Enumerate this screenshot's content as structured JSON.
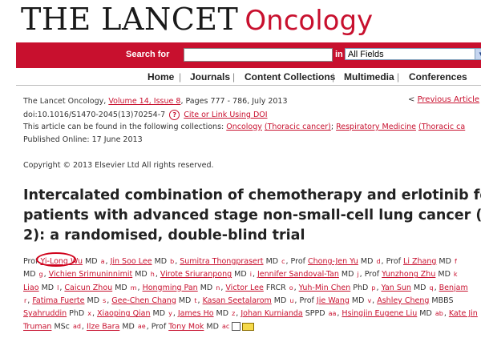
{
  "masthead": {
    "journal": "THE LANCET",
    "section": "Oncology"
  },
  "search": {
    "label": "Search for",
    "query": "",
    "in_label": "in",
    "scope": "All Fields"
  },
  "nav": {
    "items": [
      "Home",
      "Journals",
      "Content Collections",
      "Multimedia",
      "Conferences"
    ]
  },
  "citation": {
    "journal": "The Lancet Oncology, ",
    "volume_issue": "Volume 14, Issue 8",
    "pages_date": ", Pages 777 - 786, July 2013",
    "doi": "doi:10.1016/S1470-2045(13)70254-7",
    "cite_link": "Cite or Link Using DOI",
    "collections_prefix": "This article can be found in the following collections: ",
    "collection_1": "Oncology",
    "collection_1_sub": "(Thoracic cancer)",
    "collection_2": "Respiratory Medicine",
    "collection_2_sub": "(Thoracic ca",
    "published": "Published Online: 17 June 2013",
    "copyright": "Copyright © 2013 Elsevier Ltd All rights reserved."
  },
  "previous_article": "Previous Article",
  "title_lines": [
    "Intercalated combination of chemotherapy and erlotinib for",
    "patients with advanced stage non-small-cell lung cancer (FA",
    "2): a randomised, double-blind trial"
  ],
  "authors": {
    "l1": {
      "a0": "Prof ",
      "n1": "Yi-Long Wu",
      "d1": " MD ",
      "n2": "Jin Soo Lee",
      "d2": " MD ",
      "n3": "Sumitra Thongprasert",
      "d3": " MD ",
      "d4": ", Prof ",
      "n4": "Chong-Jen Yu",
      "d5": " MD ",
      "d6": ", Prof ",
      "n5": "Li Zhang",
      "d7": " MD "
    },
    "l2": {
      "a0": "MD ",
      "n1": "Vichien Srimuninnimit",
      "d1": " MD ",
      "n2": "Virote Sriuranpong",
      "d2": " MD ",
      "n3": "Jennifer Sandoval-Tan",
      "d3": " MD ",
      "d4": ", Prof ",
      "n4": "Yunzhong Zhu",
      "d5": " MD "
    },
    "l3": {
      "n1": "Liao",
      "d1": " MD ",
      "n2": "Caicun Zhou",
      "d2": " MD ",
      "n3": "Hongming Pan",
      "d3": " MD ",
      "n4": "Victor Lee",
      "d4": " FRCR ",
      "n5": "Yuh-Min Chen",
      "d5": " PhD ",
      "n6": "Yan Sun",
      "d6": " MD ",
      "n7": "Benjam"
    },
    "l4": {
      "n1": "Fatima Fuerte",
      "d1": " MD ",
      "n2": "Gee-Chen Chang",
      "d2": " MD ",
      "n3": "Kasan Seetalarom",
      "d3": " MD ",
      "d4": ", Prof ",
      "n4": "Jie Wang",
      "d5": " MD ",
      "n5": "Ashley Cheng",
      "d6": " MBBS"
    },
    "l5": {
      "n1": "Syahruddin",
      "d1": " PhD ",
      "n2": "Xiaoping Qian",
      "d2": " MD ",
      "n3": "James Ho",
      "d3": " MD ",
      "n4": "Johan Kurnianda",
      "d4": " SPPD ",
      "n5": "Hsingjin Eugene Liu",
      "d5": " MD ",
      "n6": "Kate Jin"
    },
    "l6": {
      "n1": "Truman",
      "d1": " MSc ",
      "n2": "Ilze Bara",
      "d2": " MD ",
      "d3": ", Prof ",
      "n3": "Tony Mok",
      "d4": " MD "
    }
  },
  "colors": {
    "brand_red": "#c8102e",
    "text": "#333333",
    "annotation_circle": "#d0021b"
  }
}
